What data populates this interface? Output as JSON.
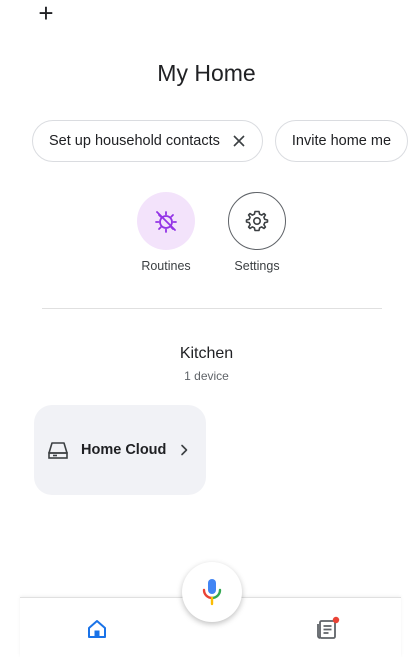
{
  "header": {
    "add_icon": "plus-icon",
    "title": "My Home"
  },
  "chips": [
    {
      "label": "Set up household contacts",
      "icon": "close-icon"
    },
    {
      "label": "Invite home me"
    }
  ],
  "actions": {
    "routines": {
      "label": "Routines",
      "icon": "routines-sun-icon",
      "bg": "#f3e3fb",
      "accent": "#9334e6"
    },
    "settings": {
      "label": "Settings",
      "icon": "gear-icon"
    }
  },
  "room": {
    "name": "Kitchen",
    "count": "1 device",
    "devices": [
      {
        "name": "Home Cloud",
        "icon": "router-icon"
      }
    ]
  },
  "bottom_nav": {
    "home": {
      "icon": "home-icon",
      "color": "#1a73e8"
    },
    "feed": {
      "icon": "feed-icon",
      "badge_color": "#ea4335"
    }
  },
  "mic": {
    "icon": "microphone-icon",
    "colors": [
      "#4285f4",
      "#ea4335",
      "#fbbc04",
      "#34a853"
    ]
  }
}
